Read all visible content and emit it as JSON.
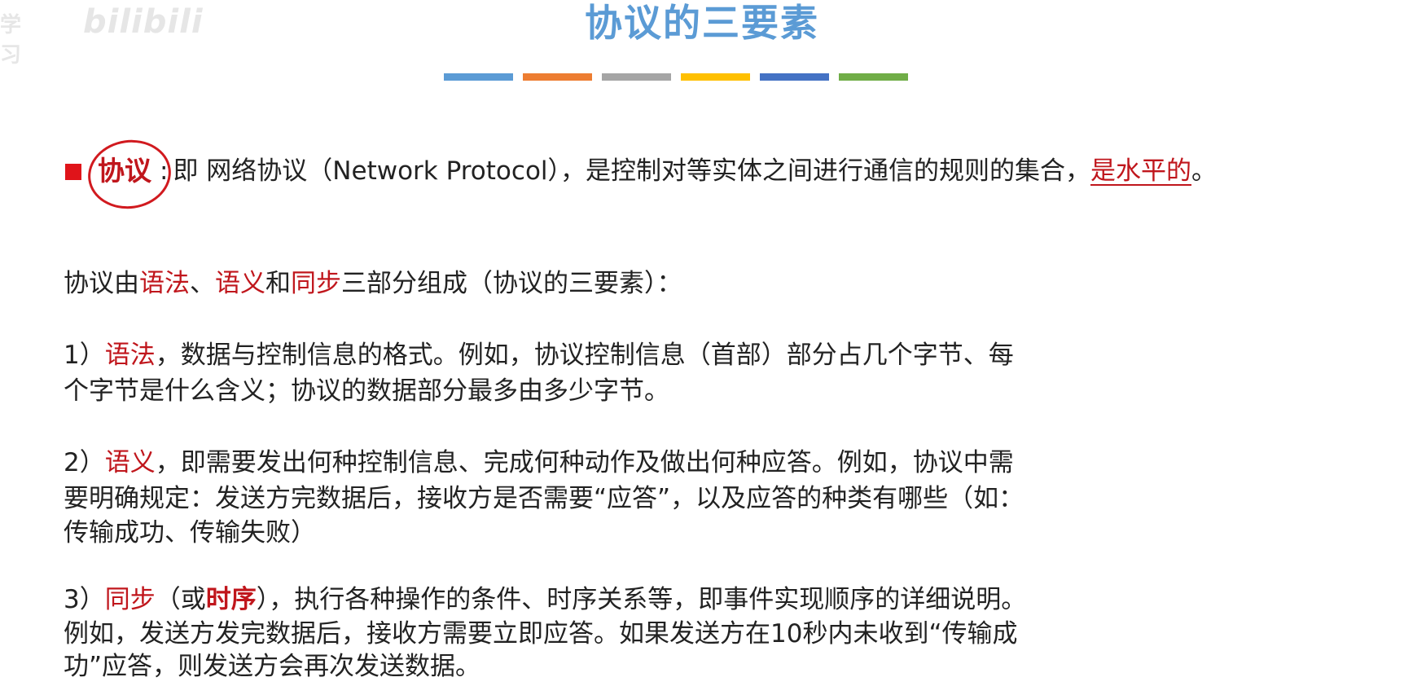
{
  "watermark": {
    "left": "学习",
    "right": "bilibili"
  },
  "title": "协议的三要素",
  "divider_colors": [
    "#5b9bd5",
    "#ed7d31",
    "#a5a5a5",
    "#ffc000",
    "#4472c4",
    "#70ad47"
  ],
  "definition": {
    "keyword": "协议",
    "colon": ":",
    "body": "即 网络协议（Network Protocol），是控制对等实体之间进行通信的规则的集合，",
    "emphasis": "是水平的",
    "end": "。"
  },
  "intro": {
    "p1": "协议由",
    "k1": "语法",
    "p2": "、",
    "k2": "语义",
    "p3": "和",
    "k3": "同步",
    "p4": "三部分组成（协议的三要素）："
  },
  "item1": {
    "num": "1）",
    "key": "语法",
    "line1_rest": "，数据与控制信息的格式。例如，协议控制信息（首部）部分占几个字节、每",
    "line2": "个字节是什么含义；协议的数据部分最多由多少字节。"
  },
  "item2": {
    "num": "2）",
    "key": "语义",
    "line1_rest": "，即需要发出何种控制信息、完成何种动作及做出何种应答。例如，协议中需",
    "line2": "要明确规定：发送方完数据后，接收方是否需要“应答”，以及应答的种类有哪些（如：",
    "line3": "传输成功、传输失败）"
  },
  "item3": {
    "num": "3）",
    "key": "同步",
    "paren_open": "（或",
    "key2": "时序",
    "line1_rest": "），执行各种操作的条件、时序关系等，即事件实现顺序的详细说明。",
    "line2": "例如，发送方发完数据后，接收方需要立即应答。如果发送方在10秒内未收到“传输成",
    "line3": "功”应答，则发送方会再次发送数据。"
  }
}
